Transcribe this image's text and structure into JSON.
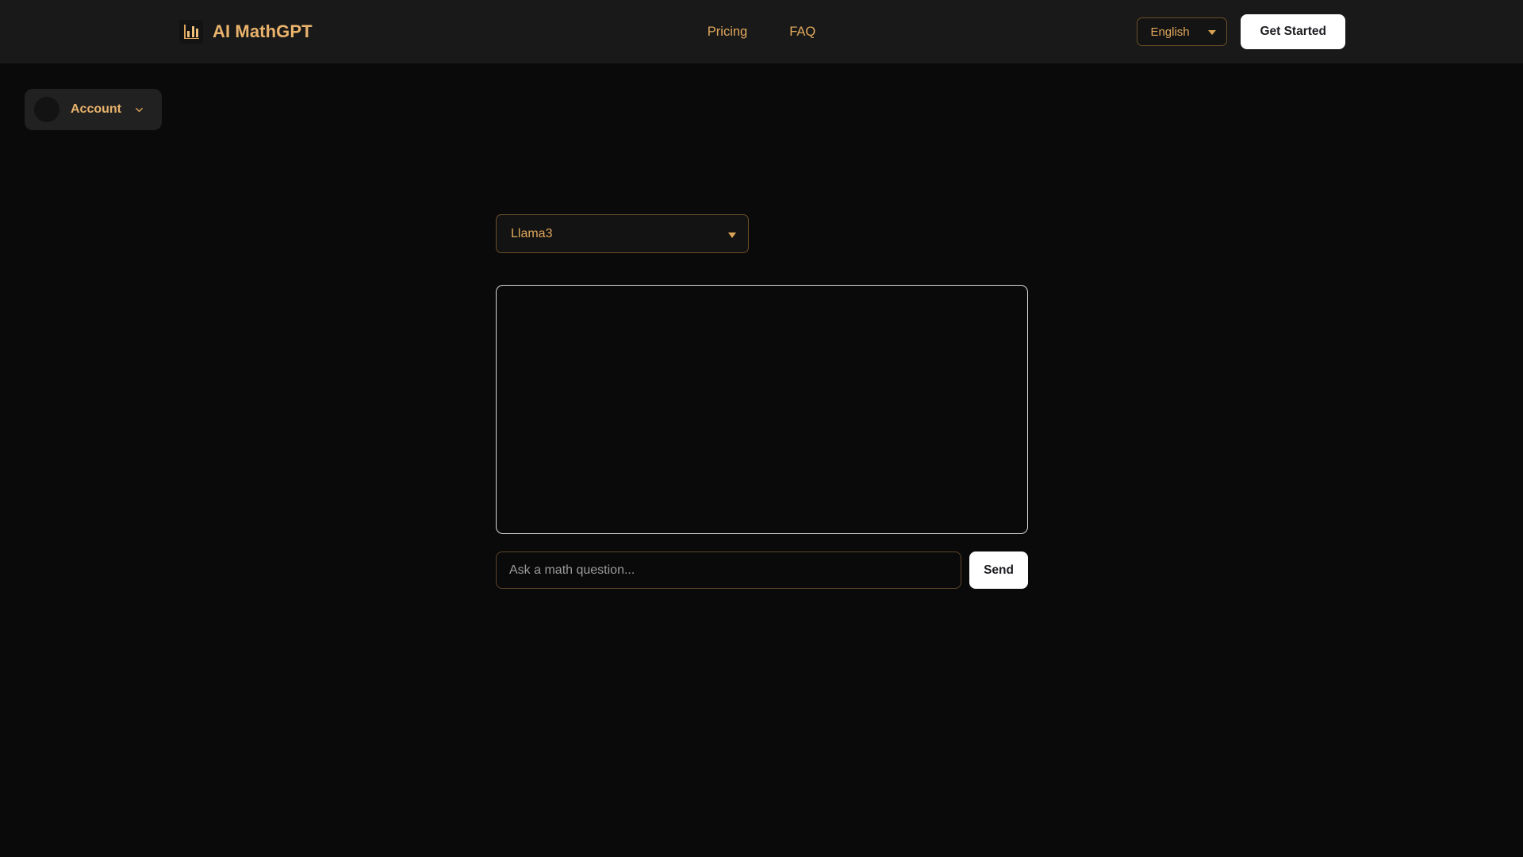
{
  "header": {
    "brand": {
      "name": "AI MathGPT",
      "icon": "bar-chart-icon",
      "accent_color": "#e9b36c"
    },
    "nav": [
      {
        "label": "Pricing"
      },
      {
        "label": "FAQ"
      }
    ],
    "language": {
      "selected": "English",
      "options": [
        "English"
      ],
      "caret_icon": "caret-down-icon"
    },
    "cta": {
      "label": "Get Started"
    },
    "background_color": "#191919"
  },
  "account": {
    "label": "Account",
    "avatar_icon": "avatar-placeholder-icon",
    "chevron_icon": "chevron-down-icon"
  },
  "main": {
    "model": {
      "selected": "Llama3",
      "options": [
        "Llama3"
      ],
      "caret_icon": "caret-down-icon"
    },
    "conversation": {
      "messages": [],
      "empty_text": ""
    },
    "composer": {
      "placeholder": "Ask a math question...",
      "value": "",
      "send_label": "Send"
    }
  },
  "theme": {
    "page_background": "#0a0a0b",
    "accent_gold": "#e0a75c",
    "accent_gold_bright": "#e9b36c",
    "button_background": "#ffffff",
    "button_text": "#1b1b20",
    "border_gold": "#6b4f27",
    "border_light": "#d8d8d8"
  }
}
